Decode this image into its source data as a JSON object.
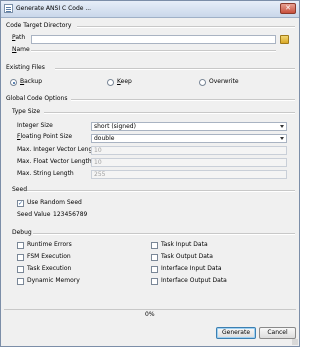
{
  "window": {
    "title": "Generate ANSI C Code ...",
    "close_icon": "close-icon",
    "app_icon": "code-generator-icon"
  },
  "code_target": {
    "heading": "Code Target Directory",
    "path_label": "Path",
    "path_value": "",
    "name_label": "Name",
    "browse_icon": "folder-icon"
  },
  "existing_files": {
    "heading": "Existing Files",
    "options": [
      "Backup",
      "Keep",
      "Overwrite"
    ],
    "selected": "Backup"
  },
  "global_options": {
    "heading": "Global Code Options",
    "type_size": {
      "heading": "Type Size",
      "integer_size_label": "Integer Size",
      "integer_size_value": "short (signed)",
      "float_size_label": "Floating Point Size",
      "float_size_value": "double",
      "max_int_vec_label": "Max. Integer Vector Length",
      "max_int_vec_value": "10",
      "max_float_vec_label": "Max. Float Vector Length",
      "max_float_vec_value": "10",
      "max_string_label": "Max. String Length",
      "max_string_value": "255"
    },
    "seed": {
      "heading": "Seed",
      "use_random_label": "Use Random Seed",
      "use_random_checked": true,
      "seed_value_label": "Seed Value",
      "seed_value": "123456789"
    },
    "debug": {
      "heading": "Debug",
      "left": [
        "Runtime Errors",
        "FSM Execution",
        "Task Execution",
        "Dynamic Memory"
      ],
      "right": [
        "Task Input Data",
        "Task Output Data",
        "Interface Input Data",
        "Interface Output Data"
      ]
    }
  },
  "progress": {
    "value": 0,
    "label": "0%"
  },
  "buttons": {
    "generate": "Generate",
    "cancel": "Cancel"
  }
}
